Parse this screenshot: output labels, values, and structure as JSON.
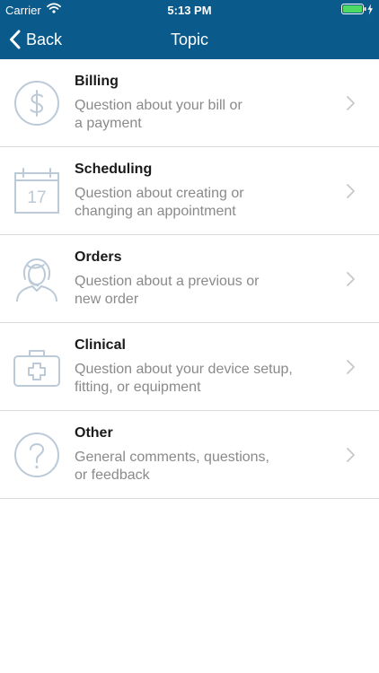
{
  "status_bar": {
    "carrier": "Carrier",
    "time": "5:13 PM"
  },
  "nav": {
    "back_label": "Back",
    "title": "Topic"
  },
  "colors": {
    "nav_background": "#0b5a8c",
    "icon_stroke": "#bccad8",
    "title_text": "#1a1a1a",
    "description_text": "#8a8a8a",
    "battery_fill": "#4cd964"
  },
  "topics": [
    {
      "icon": "dollar-icon",
      "title": "Billing",
      "description": "Question about your bill or\na payment"
    },
    {
      "icon": "calendar-icon",
      "title": "Scheduling",
      "description": "Question about creating or\nchanging an appointment",
      "icon_text": "17"
    },
    {
      "icon": "headset-agent-icon",
      "title": "Orders",
      "description": "Question about a previous or\nnew order"
    },
    {
      "icon": "medical-kit-icon",
      "title": "Clinical",
      "description": "Question about your device setup,\nfitting, or equipment"
    },
    {
      "icon": "question-icon",
      "title": "Other",
      "description": "General comments, questions,\nor feedback"
    }
  ]
}
